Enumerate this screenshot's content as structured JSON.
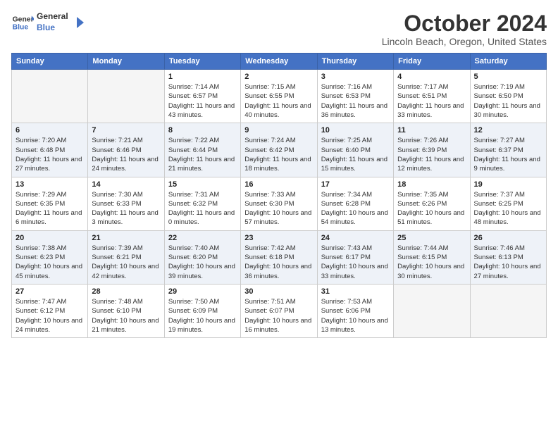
{
  "header": {
    "logo_line1": "General",
    "logo_line2": "Blue",
    "month": "October 2024",
    "location": "Lincoln Beach, Oregon, United States"
  },
  "days_of_week": [
    "Sunday",
    "Monday",
    "Tuesday",
    "Wednesday",
    "Thursday",
    "Friday",
    "Saturday"
  ],
  "weeks": [
    [
      {
        "day": "",
        "empty": true
      },
      {
        "day": "",
        "empty": true
      },
      {
        "day": "1",
        "sunrise": "7:14 AM",
        "sunset": "6:57 PM",
        "daylight": "11 hours and 43 minutes."
      },
      {
        "day": "2",
        "sunrise": "7:15 AM",
        "sunset": "6:55 PM",
        "daylight": "11 hours and 40 minutes."
      },
      {
        "day": "3",
        "sunrise": "7:16 AM",
        "sunset": "6:53 PM",
        "daylight": "11 hours and 36 minutes."
      },
      {
        "day": "4",
        "sunrise": "7:17 AM",
        "sunset": "6:51 PM",
        "daylight": "11 hours and 33 minutes."
      },
      {
        "day": "5",
        "sunrise": "7:19 AM",
        "sunset": "6:50 PM",
        "daylight": "11 hours and 30 minutes."
      }
    ],
    [
      {
        "day": "6",
        "sunrise": "7:20 AM",
        "sunset": "6:48 PM",
        "daylight": "11 hours and 27 minutes."
      },
      {
        "day": "7",
        "sunrise": "7:21 AM",
        "sunset": "6:46 PM",
        "daylight": "11 hours and 24 minutes."
      },
      {
        "day": "8",
        "sunrise": "7:22 AM",
        "sunset": "6:44 PM",
        "daylight": "11 hours and 21 minutes."
      },
      {
        "day": "9",
        "sunrise": "7:24 AM",
        "sunset": "6:42 PM",
        "daylight": "11 hours and 18 minutes."
      },
      {
        "day": "10",
        "sunrise": "7:25 AM",
        "sunset": "6:40 PM",
        "daylight": "11 hours and 15 minutes."
      },
      {
        "day": "11",
        "sunrise": "7:26 AM",
        "sunset": "6:39 PM",
        "daylight": "11 hours and 12 minutes."
      },
      {
        "day": "12",
        "sunrise": "7:27 AM",
        "sunset": "6:37 PM",
        "daylight": "11 hours and 9 minutes."
      }
    ],
    [
      {
        "day": "13",
        "sunrise": "7:29 AM",
        "sunset": "6:35 PM",
        "daylight": "11 hours and 6 minutes."
      },
      {
        "day": "14",
        "sunrise": "7:30 AM",
        "sunset": "6:33 PM",
        "daylight": "11 hours and 3 minutes."
      },
      {
        "day": "15",
        "sunrise": "7:31 AM",
        "sunset": "6:32 PM",
        "daylight": "11 hours and 0 minutes."
      },
      {
        "day": "16",
        "sunrise": "7:33 AM",
        "sunset": "6:30 PM",
        "daylight": "10 hours and 57 minutes."
      },
      {
        "day": "17",
        "sunrise": "7:34 AM",
        "sunset": "6:28 PM",
        "daylight": "10 hours and 54 minutes."
      },
      {
        "day": "18",
        "sunrise": "7:35 AM",
        "sunset": "6:26 PM",
        "daylight": "10 hours and 51 minutes."
      },
      {
        "day": "19",
        "sunrise": "7:37 AM",
        "sunset": "6:25 PM",
        "daylight": "10 hours and 48 minutes."
      }
    ],
    [
      {
        "day": "20",
        "sunrise": "7:38 AM",
        "sunset": "6:23 PM",
        "daylight": "10 hours and 45 minutes."
      },
      {
        "day": "21",
        "sunrise": "7:39 AM",
        "sunset": "6:21 PM",
        "daylight": "10 hours and 42 minutes."
      },
      {
        "day": "22",
        "sunrise": "7:40 AM",
        "sunset": "6:20 PM",
        "daylight": "10 hours and 39 minutes."
      },
      {
        "day": "23",
        "sunrise": "7:42 AM",
        "sunset": "6:18 PM",
        "daylight": "10 hours and 36 minutes."
      },
      {
        "day": "24",
        "sunrise": "7:43 AM",
        "sunset": "6:17 PM",
        "daylight": "10 hours and 33 minutes."
      },
      {
        "day": "25",
        "sunrise": "7:44 AM",
        "sunset": "6:15 PM",
        "daylight": "10 hours and 30 minutes."
      },
      {
        "day": "26",
        "sunrise": "7:46 AM",
        "sunset": "6:13 PM",
        "daylight": "10 hours and 27 minutes."
      }
    ],
    [
      {
        "day": "27",
        "sunrise": "7:47 AM",
        "sunset": "6:12 PM",
        "daylight": "10 hours and 24 minutes."
      },
      {
        "day": "28",
        "sunrise": "7:48 AM",
        "sunset": "6:10 PM",
        "daylight": "10 hours and 21 minutes."
      },
      {
        "day": "29",
        "sunrise": "7:50 AM",
        "sunset": "6:09 PM",
        "daylight": "10 hours and 19 minutes."
      },
      {
        "day": "30",
        "sunrise": "7:51 AM",
        "sunset": "6:07 PM",
        "daylight": "10 hours and 16 minutes."
      },
      {
        "day": "31",
        "sunrise": "7:53 AM",
        "sunset": "6:06 PM",
        "daylight": "10 hours and 13 minutes."
      },
      {
        "day": "",
        "empty": true
      },
      {
        "day": "",
        "empty": true
      }
    ]
  ],
  "labels": {
    "sunrise": "Sunrise:",
    "sunset": "Sunset:",
    "daylight": "Daylight:"
  }
}
